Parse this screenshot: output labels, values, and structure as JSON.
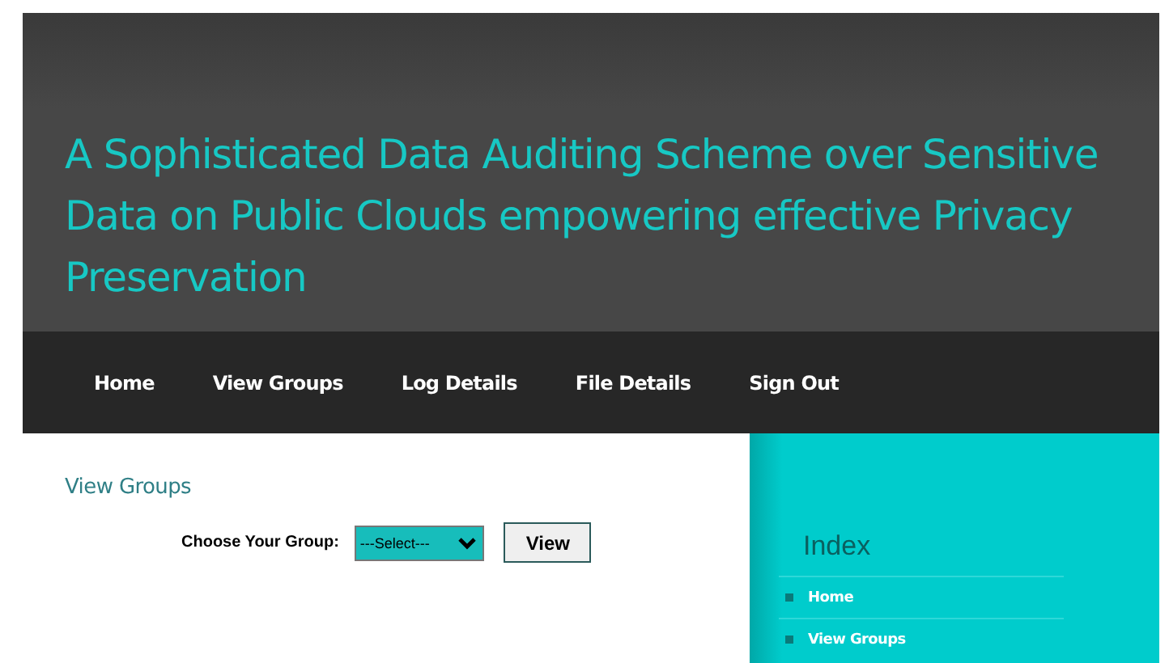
{
  "header": {
    "title": "A Sophisticated Data Auditing Scheme over Sensitive Data on Public Clouds empowering effective Privacy Preservation"
  },
  "nav": {
    "items": [
      "Home",
      "View Groups",
      "Log Details",
      "File Details",
      "Sign Out"
    ]
  },
  "main": {
    "heading": "View Groups",
    "form": {
      "label": "Choose Your Group:",
      "select": {
        "value": "---Select---"
      },
      "button": "View"
    }
  },
  "sidebar": {
    "heading": "Index",
    "items": [
      "Home",
      "View Groups"
    ]
  }
}
